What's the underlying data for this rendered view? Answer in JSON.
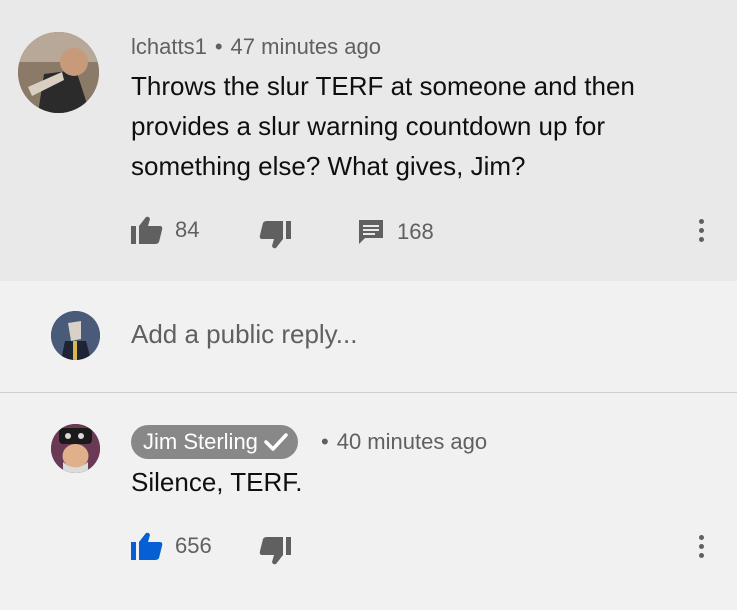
{
  "comments": [
    {
      "author": "lchatts1",
      "time": "47 minutes ago",
      "text_lines": [
        "Throws the slur TERF at someone and then",
        "provides a slur warning countdown up for",
        "something else? What gives, Jim?"
      ],
      "likes": "84",
      "replies": "168",
      "like_active": false
    },
    {
      "author": "Jim Sterling",
      "verified": true,
      "time": "40 minutes ago",
      "text": "Silence, TERF.",
      "likes": "656",
      "like_active": true
    }
  ],
  "reply_box": {
    "placeholder": "Add a public reply..."
  },
  "meta_separator": "•",
  "colors": {
    "like_active": "#065fd4",
    "icon": "#606060",
    "badge": "#888888",
    "highlight_bg": "#e9e9e9",
    "page_bg": "#f1f1f1"
  }
}
